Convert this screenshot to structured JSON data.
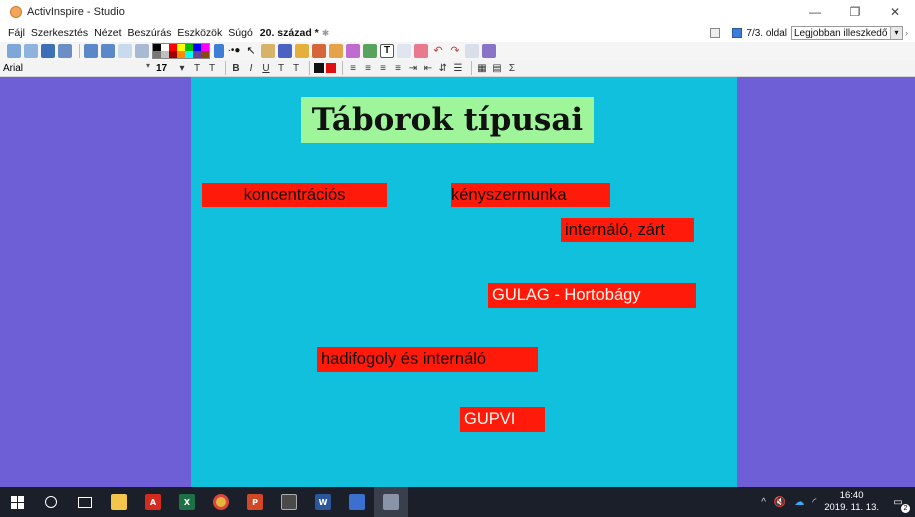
{
  "window": {
    "title": "ActivInspire - Studio",
    "controls": {
      "minimize": "—",
      "restore": "❐",
      "close": "✕"
    }
  },
  "menubar": {
    "items": [
      "Fájl",
      "Szerkesztés",
      "Nézet",
      "Beszúrás",
      "Eszközök",
      "Súgó"
    ],
    "document_tab": "20. század *",
    "page_indicator": "7/3. oldal",
    "zoom_value": "Legjobban illeszkedő"
  },
  "format_toolbar": {
    "font": "Arial",
    "size": "17"
  },
  "slide": {
    "title": "Táborok típusai",
    "labels": [
      {
        "text": "koncentrációs"
      },
      {
        "text": "kényszermunka"
      },
      {
        "text": "internáló, zárt"
      },
      {
        "text": "GULAG - Hortobágy"
      },
      {
        "text": "hadifogoly és internáló"
      },
      {
        "text": "GUPVI"
      }
    ],
    "colors": {
      "background": "#6e5fd7",
      "page": "#10c0dd",
      "title_box": "#9ef59a",
      "label_box": "#ff1a0a"
    }
  },
  "taskbar": {
    "apps": [
      "start-icon",
      "search-icon",
      "task-view-icon",
      "file-explorer-icon",
      "acrobat-icon",
      "excel-icon",
      "chrome-icon",
      "powerpoint-icon",
      "calculator-icon",
      "word-icon",
      "save-app-icon",
      "activinspire-icon"
    ],
    "time": "16:40",
    "date": "2019. 11. 13.",
    "notifications": "2"
  }
}
